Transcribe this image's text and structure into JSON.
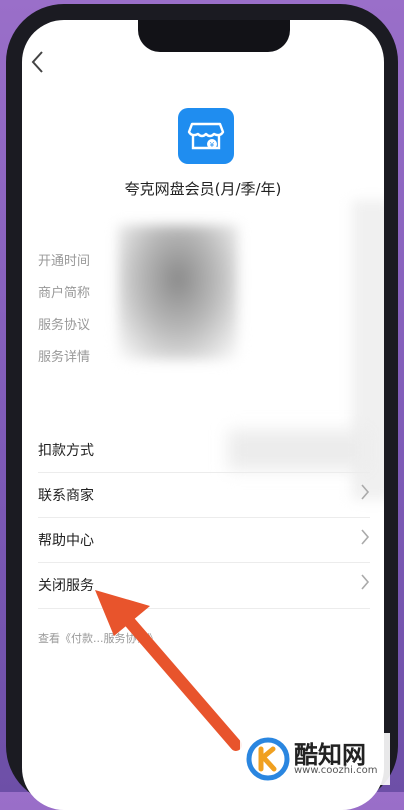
{
  "header": {
    "back_icon": "chevron-left-icon"
  },
  "app": {
    "icon": "storefront-icon",
    "icon_color": "#1f8df0",
    "title": "夸克网盘会员(月/季/年)"
  },
  "info_labels": [
    "开通时间",
    "商户简称",
    "服务协议",
    "服务详情"
  ],
  "menu": {
    "deduction_method": "扣款方式",
    "contact_merchant": "联系商家",
    "help_center": "帮助中心",
    "close_service": "关闭服务"
  },
  "agreement_text": "查看《付款...服务协议》",
  "annotation": {
    "arrow_color": "#e8542c"
  },
  "watermark": {
    "name": "酷知网",
    "url": "www.coozhi.com"
  }
}
